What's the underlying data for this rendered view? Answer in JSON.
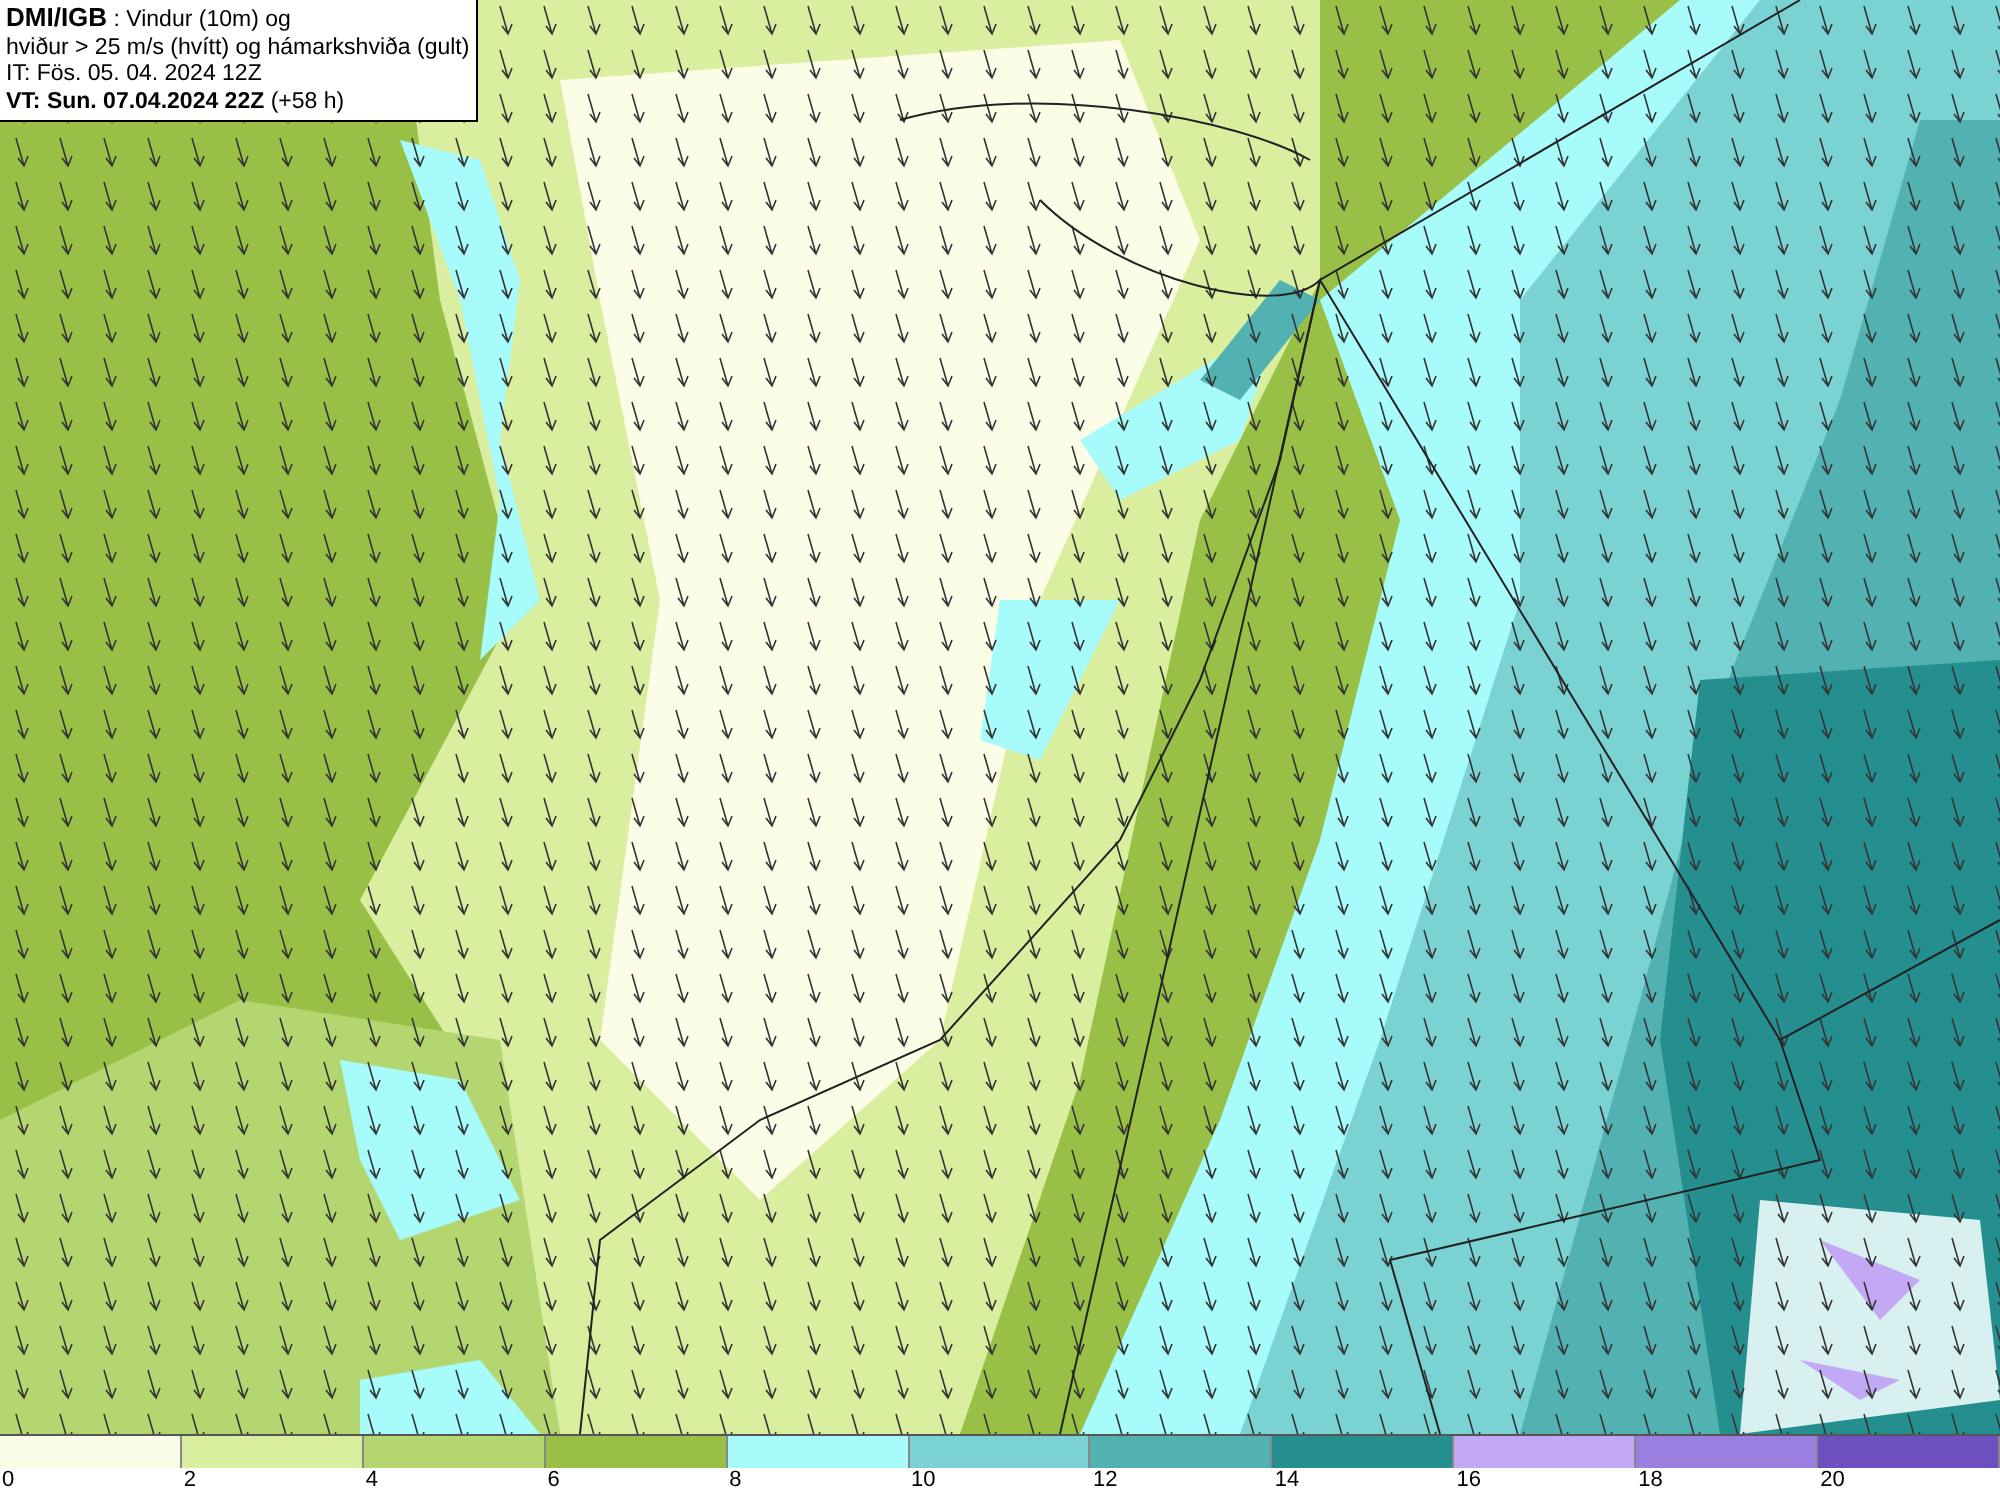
{
  "header": {
    "source": "DMI/IGB",
    "title_rest": " : Vindur (10m) og",
    "line_2": "hviður > 25 m/s (hvítt) og hámarkshviða (gult)",
    "issue_time": "IT: Fös. 05. 04. 2024 12Z",
    "valid_time": "VT: Sun. 07.04.2024 22Z",
    "lead": " (+58 h)"
  },
  "legend": {
    "bins": [
      {
        "color": "#fbfde6"
      },
      {
        "color": "#daeea0"
      },
      {
        "color": "#b3d670"
      },
      {
        "color": "#99c046"
      },
      {
        "color": "#a8fbfb"
      },
      {
        "color": "#7ad2d2"
      },
      {
        "color": "#52b2b2"
      },
      {
        "color": "#258f8f"
      },
      {
        "color": "#c3a8f5"
      },
      {
        "color": "#9a7ee0"
      },
      {
        "color": "#6e4fc0"
      }
    ],
    "labels": [
      "0",
      "2",
      "4",
      "6",
      "8",
      "10",
      "12",
      "14",
      "16",
      "18",
      "20"
    ]
  }
}
